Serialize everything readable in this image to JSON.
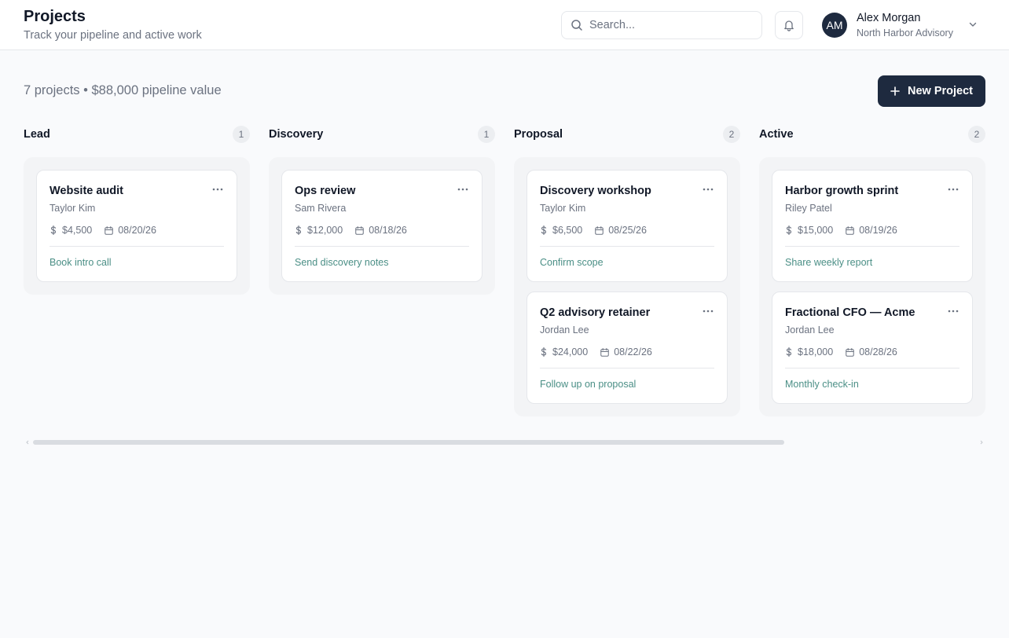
{
  "header": {
    "title": "Projects",
    "subtitle": "Track your pipeline and active work",
    "search_placeholder": "Search...",
    "user": {
      "initials": "AM",
      "name": "Alex Morgan",
      "org": "North Harbor Advisory"
    }
  },
  "summary": {
    "text": "7 projects • $88,000 pipeline value",
    "new_project_label": "New Project"
  },
  "colors": {
    "primary": "#1e2a3f",
    "accent_link": "#4b8f86",
    "border": "#e5e7eb",
    "column_bg": "#f3f4f6"
  },
  "columns": [
    {
      "title": "Lead",
      "count": "1",
      "cards": [
        {
          "title": "Website audit",
          "client": "Taylor Kim",
          "value": "$4,500",
          "date": "08/20/26",
          "next_step": "Book intro call"
        }
      ]
    },
    {
      "title": "Discovery",
      "count": "1",
      "cards": [
        {
          "title": "Ops review",
          "client": "Sam Rivera",
          "value": "$12,000",
          "date": "08/18/26",
          "next_step": "Send discovery notes"
        }
      ]
    },
    {
      "title": "Proposal",
      "count": "2",
      "cards": [
        {
          "title": "Discovery workshop",
          "client": "Taylor Kim",
          "value": "$6,500",
          "date": "08/25/26",
          "next_step": "Confirm scope"
        },
        {
          "title": "Q2 advisory retainer",
          "client": "Jordan Lee",
          "value": "$24,000",
          "date": "08/22/26",
          "next_step": "Follow up on proposal"
        }
      ]
    },
    {
      "title": "Active",
      "count": "2",
      "cards": [
        {
          "title": "Harbor growth sprint",
          "client": "Riley Patel",
          "value": "$15,000",
          "date": "08/19/26",
          "next_step": "Share weekly report"
        },
        {
          "title": "Fractional CFO — Acme",
          "client": "Jordan Lee",
          "value": "$18,000",
          "date": "08/28/26",
          "next_step": "Monthly check-in"
        }
      ]
    }
  ]
}
